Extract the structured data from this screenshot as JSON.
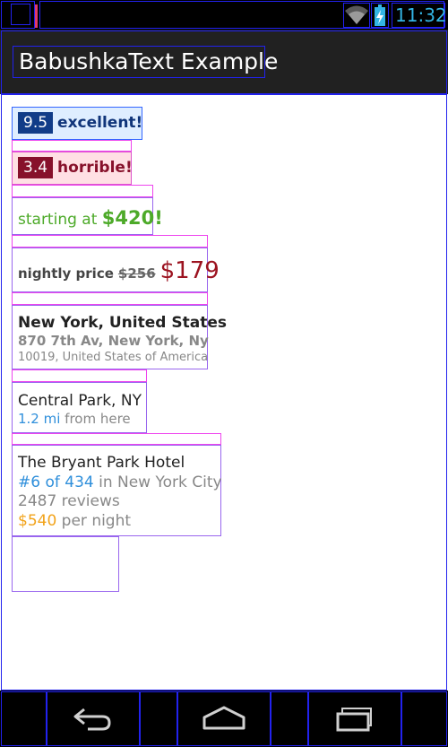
{
  "status_bar": {
    "time": "11:32",
    "icons": [
      "wifi-icon",
      "battery-charging-icon"
    ],
    "accent_color": "#33b5e5"
  },
  "action_bar": {
    "title": "BabushkaText Example"
  },
  "examples": {
    "rating_good": {
      "score": "9.5",
      "label": "excellent!",
      "badge_color": "#113c88",
      "bg_color": "#dfeeff"
    },
    "rating_bad": {
      "score": "3.4",
      "label": "horrible!",
      "badge_color": "#87112b",
      "bg_color": "#ffe0e4"
    },
    "starting_price": {
      "prefix": "starting at ",
      "price": "$420!",
      "color": "#4daa29"
    },
    "nightly_price": {
      "label": "nightly price",
      "old_price": "$256",
      "new_price": "$179",
      "new_price_color": "#9c1320"
    },
    "address": {
      "line1": "New York, United States",
      "line2": "870 7th Av, New York, Ny",
      "line3": "10019, United States of America"
    },
    "distance": {
      "place": "Central Park, NY",
      "distance": "1.2 mi",
      "suffix": " from here",
      "distance_color": "#2f8fdb"
    },
    "hotel": {
      "name": "The Bryant Park Hotel",
      "rank": "#6 of 434",
      "rank_suffix": " in New York City",
      "reviews": "2487 reviews",
      "price": "$540",
      "price_suffix": " per night",
      "rank_color": "#2f8fdb",
      "price_color": "#f2a31a"
    }
  },
  "nav_bar": {
    "buttons": [
      "back-icon",
      "home-icon",
      "recent-apps-icon"
    ]
  }
}
